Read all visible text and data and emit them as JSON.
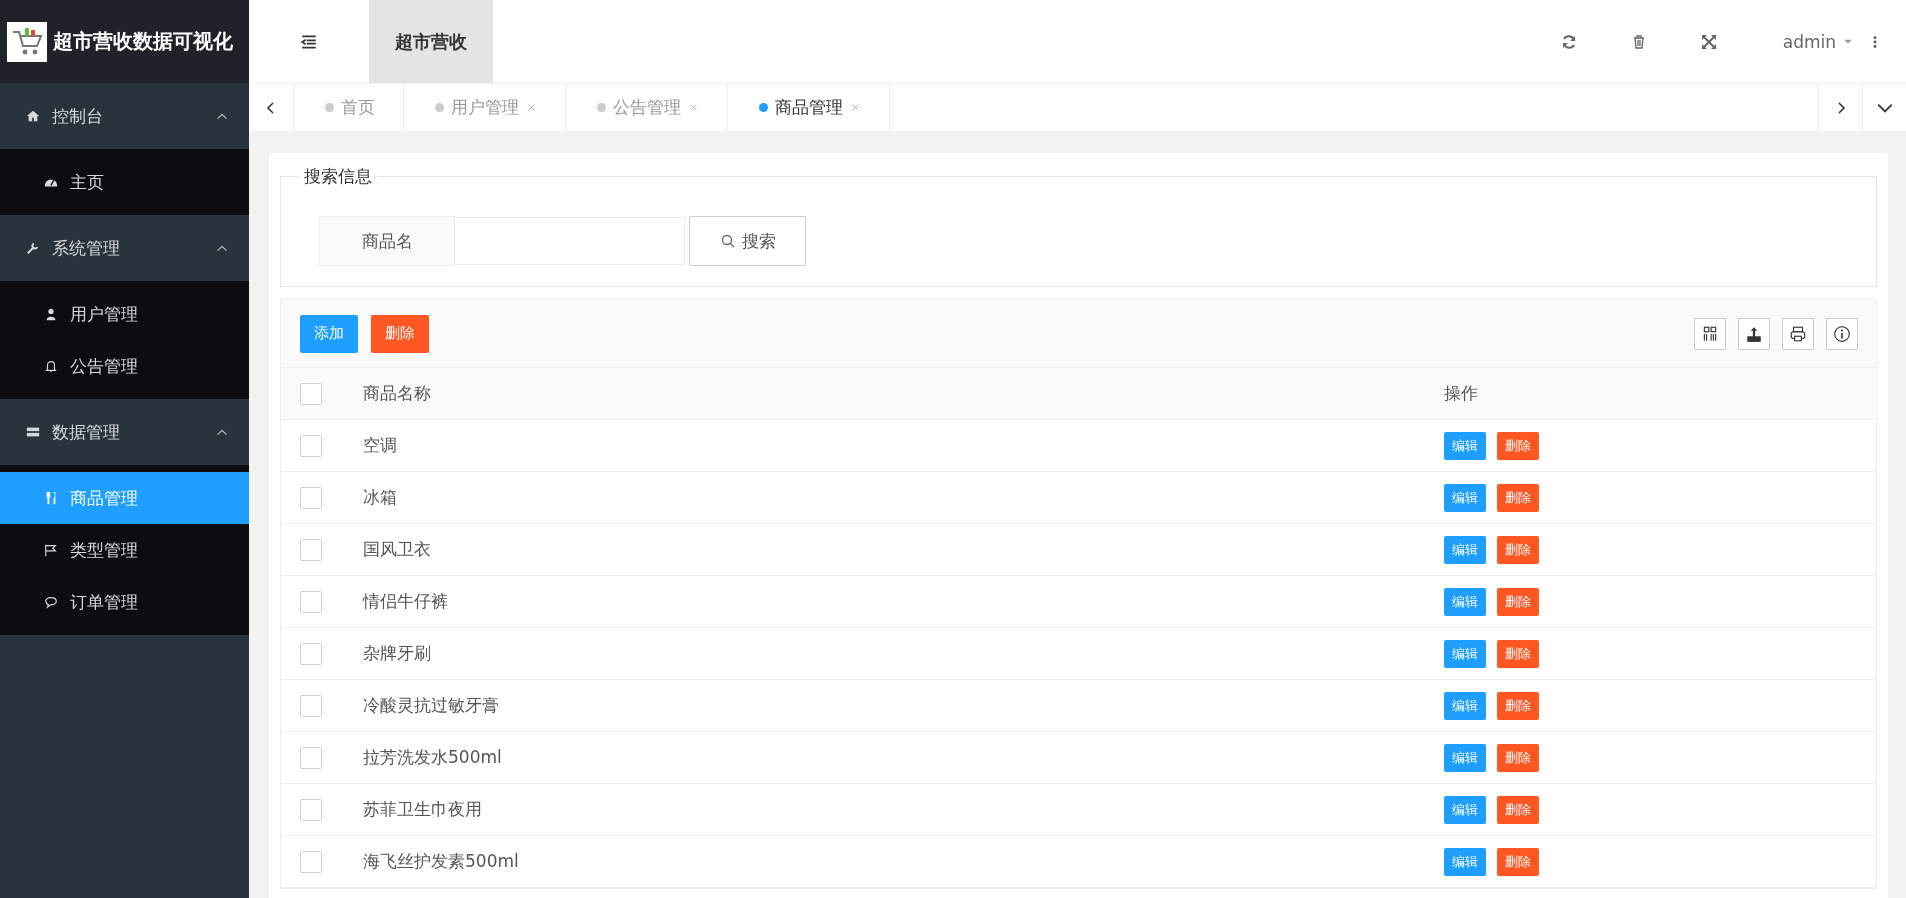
{
  "app": {
    "title": "超市营收数据可视化"
  },
  "header": {
    "module_tab": "超市营收",
    "user": "admin"
  },
  "tabs": [
    {
      "label": "首页",
      "selected": false,
      "closable": false
    },
    {
      "label": "用户管理",
      "selected": false,
      "closable": true
    },
    {
      "label": "公告管理",
      "selected": false,
      "closable": true
    },
    {
      "label": "商品管理",
      "selected": true,
      "closable": true
    }
  ],
  "sidebar": {
    "groups": [
      {
        "label": "控制台",
        "expanded": true,
        "children": [
          {
            "label": "主页",
            "selected": false
          }
        ]
      },
      {
        "label": "系统管理",
        "expanded": true,
        "children": [
          {
            "label": "用户管理",
            "selected": false
          },
          {
            "label": "公告管理",
            "selected": false
          }
        ]
      },
      {
        "label": "数据管理",
        "expanded": true,
        "children": [
          {
            "label": "商品管理",
            "selected": true
          },
          {
            "label": "类型管理",
            "selected": false
          },
          {
            "label": "订单管理",
            "selected": false
          }
        ]
      }
    ]
  },
  "search": {
    "legend": "搜索信息",
    "field_label": "商品名",
    "button": "搜索"
  },
  "toolbar": {
    "add": "添加",
    "delete": "删除"
  },
  "table": {
    "columns": [
      "商品名称",
      "操作"
    ],
    "select_all_checked": false,
    "rows": [
      {
        "name": "空调",
        "checked": false,
        "edit": "编辑",
        "remove": "删除"
      },
      {
        "name": "冰箱",
        "checked": false,
        "edit": "编辑",
        "remove": "删除"
      },
      {
        "name": "国风卫衣",
        "checked": false,
        "edit": "编辑",
        "remove": "删除"
      },
      {
        "name": "情侣牛仔裤",
        "checked": false,
        "edit": "编辑",
        "remove": "删除"
      },
      {
        "name": "杂牌牙刷",
        "checked": false,
        "edit": "编辑",
        "remove": "删除"
      },
      {
        "name": "冷酸灵抗过敏牙膏",
        "checked": false,
        "edit": "编辑",
        "remove": "删除"
      },
      {
        "name": "拉芳洗发水500ml",
        "checked": false,
        "edit": "编辑",
        "remove": "删除"
      },
      {
        "name": "苏菲卫生巾夜用",
        "checked": false,
        "edit": "编辑",
        "remove": "删除"
      },
      {
        "name": "海飞丝护发素500ml",
        "checked": false,
        "edit": "编辑",
        "remove": "删除"
      }
    ]
  }
}
